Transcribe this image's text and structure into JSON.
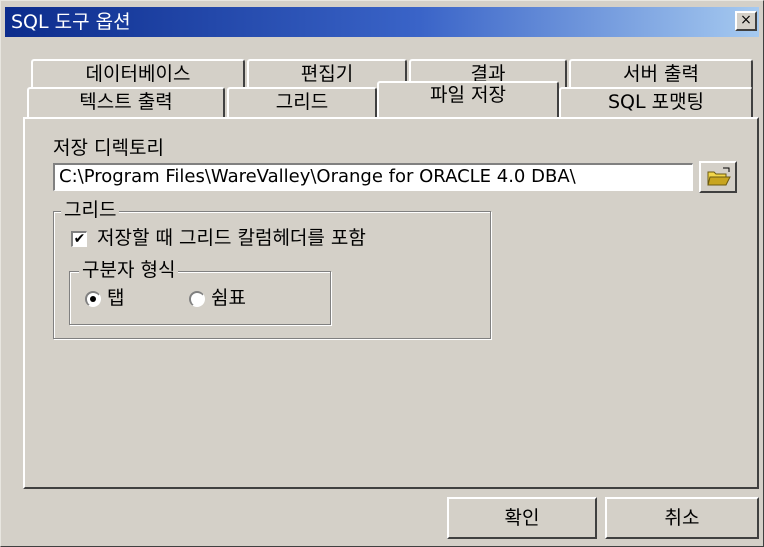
{
  "window": {
    "title": "SQL 도구 옵션",
    "close_glyph": "×"
  },
  "tabs": {
    "back_row": [
      "데이터베이스",
      "편집기",
      "결과",
      "서버 출력"
    ],
    "front_row": [
      "텍스트 출력",
      "그리드",
      "파일 저장",
      "SQL 포맷팅"
    ],
    "active": "파일 저장"
  },
  "panel": {
    "save_dir_label": "저장 디렉토리",
    "save_dir_value": "C:\\Program Files\\WareValley\\Orange for ORACLE 4.0 DBA\\",
    "browse_icon": "folder-open-icon",
    "grid_group": {
      "title": "그리드",
      "include_header_label": "저장할 때 그리드 칼럼헤더를 포함",
      "include_header_checked": true,
      "delimiter_group": {
        "title": "구분자 형식",
        "options": [
          "탭",
          "쉼표"
        ],
        "selected": "탭"
      }
    }
  },
  "buttons": {
    "ok": "확인",
    "cancel": "취소"
  },
  "colors": {
    "title_gradient_start": "#0c2c8c",
    "title_gradient_end": "#a6caf0",
    "face": "#d4d0c8"
  }
}
